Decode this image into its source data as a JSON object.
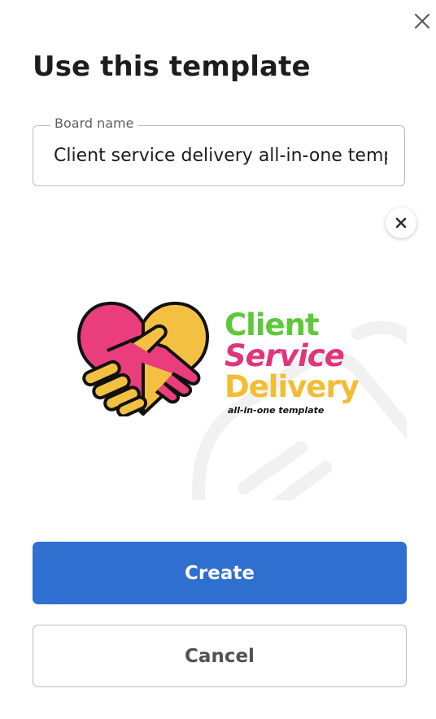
{
  "dialog": {
    "title": "Use this template",
    "close_icon": "close-icon"
  },
  "board_name": {
    "label": "Board name",
    "value": "Client service delivery all-in-one template"
  },
  "template_image": {
    "remove_icon": "close-icon",
    "brand": {
      "line1": "Client",
      "line2": "Service",
      "line3": "Delivery",
      "tagline": "all-in-one template"
    },
    "colors": {
      "green": "#5cc93a",
      "pink": "#e0357a",
      "yellow": "#f2bd33",
      "heart_pink": "#ea3d7c",
      "heart_yellow": "#f4c042",
      "outline": "#111111"
    }
  },
  "actions": {
    "create_label": "Create",
    "cancel_label": "Cancel"
  },
  "colors": {
    "primary": "#2f6fcf",
    "border": "#b9bcc2",
    "text": "#1d1d1f"
  }
}
